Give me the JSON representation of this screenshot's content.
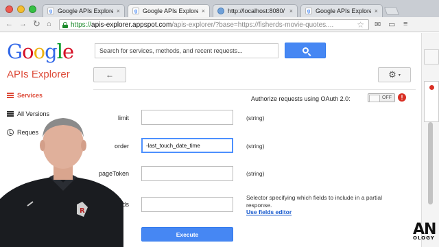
{
  "browser": {
    "tabs": [
      {
        "title": "Google APIs Explorer",
        "favicon": "google-g"
      },
      {
        "title": "Google APIs Explorer",
        "favicon": "google-g"
      },
      {
        "title": "http://localhost:8080/ ii",
        "favicon": "globe"
      },
      {
        "title": "Google APIs Explorer",
        "favicon": "google-g"
      }
    ],
    "close_glyph": "×",
    "url": {
      "scheme": "https://",
      "host": "apis-explorer.appspot.com",
      "path": "/apis-explorer/?base=https://fisherds-movie-quotes...."
    }
  },
  "header": {
    "logo_letters": [
      "G",
      "o",
      "o",
      "g",
      "l",
      "e"
    ],
    "logo_colors": [
      "#3369e8",
      "#d50f25",
      "#eeb211",
      "#3369e8",
      "#009925",
      "#d50f25"
    ],
    "search_placeholder": "Search for services, methods, and recent requests...",
    "app_title": "APIs Explorer",
    "back_glyph": "←",
    "gear_glyph": "⚙",
    "caret_glyph": "▾"
  },
  "sidebar": {
    "items": [
      {
        "label": "Services",
        "active": true
      },
      {
        "label": "All Versions",
        "active": false
      },
      {
        "label": "Reques",
        "active": false
      }
    ]
  },
  "auth": {
    "label": "Authorize requests using OAuth 2.0:",
    "toggle_state": "OFF",
    "warn_glyph": "!"
  },
  "params": [
    {
      "name": "limit",
      "value": "",
      "type": "(string)"
    },
    {
      "name": "order",
      "value": "-last_touch_date_time",
      "type": "(string)"
    },
    {
      "name": "pageToken",
      "value": "",
      "type": "(string)"
    },
    {
      "name": "fields",
      "value": "",
      "type": ""
    }
  ],
  "fields_description": "Selector specifying which fields to include in a partial response.",
  "fields_link": "Use fields editor",
  "execute_label": "Execute",
  "watermark": {
    "main": "AN",
    "sub": "OLOGY"
  },
  "colors": {
    "accent_red": "#dd4b39",
    "button_blue": "#4687f3",
    "link_blue": "#1155cc"
  }
}
